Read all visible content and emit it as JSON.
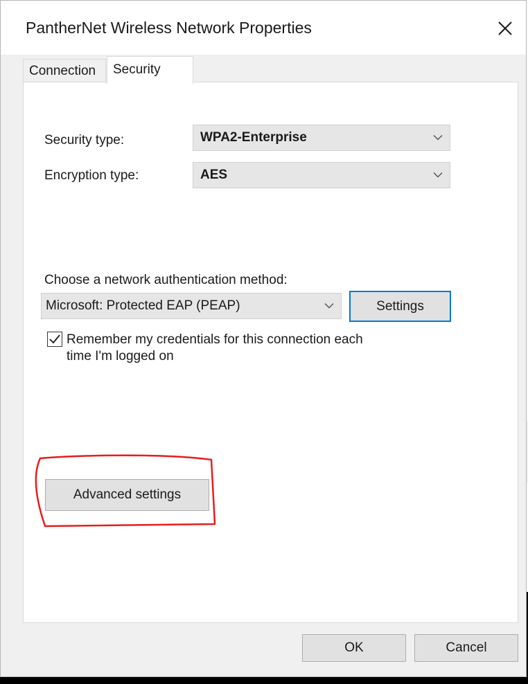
{
  "window": {
    "title": "PantherNet Wireless Network Properties"
  },
  "tabs": [
    {
      "label": "Connection",
      "active": false
    },
    {
      "label": "Security",
      "active": true
    }
  ],
  "security": {
    "security_type_label": "Security type:",
    "security_type_value": "WPA2-Enterprise",
    "encryption_type_label": "Encryption type:",
    "encryption_type_value": "AES",
    "auth_method_label": "Choose a network authentication method:",
    "auth_method_value": "Microsoft: Protected EAP (PEAP)",
    "settings_button": "Settings",
    "remember_checkbox_checked": true,
    "remember_line1": "Remember my credentials for this connection each",
    "remember_line2": "time I'm logged on",
    "advanced_settings_button": "Advanced settings"
  },
  "footer": {
    "ok_button": "OK",
    "cancel_button": "Cancel"
  },
  "colors": {
    "focus_border": "#0078d7",
    "annotation": "#e81c1c"
  }
}
